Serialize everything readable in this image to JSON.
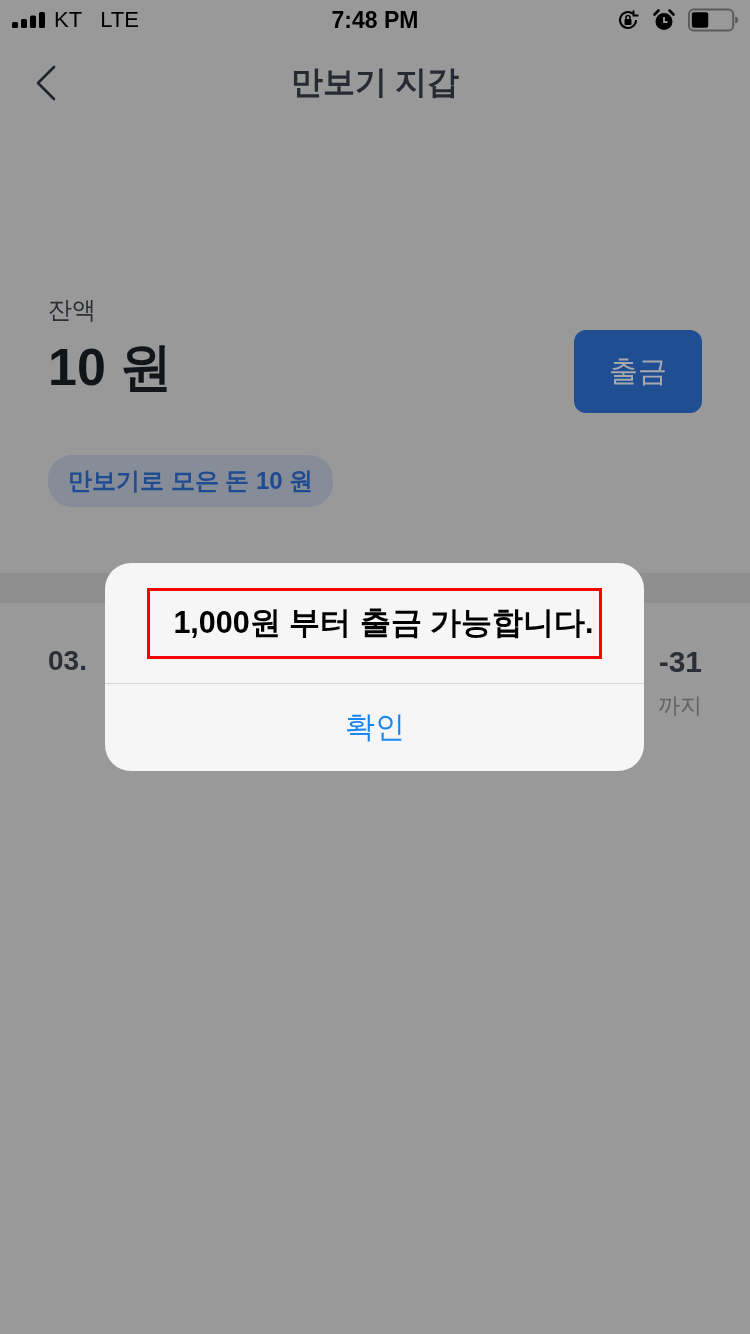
{
  "status_bar": {
    "carrier": "KT",
    "network": "LTE",
    "time": "7:48 PM"
  },
  "nav": {
    "title": "만보기 지갑"
  },
  "balance": {
    "label": "잔액",
    "amount": "10 원",
    "withdraw_button": "출금",
    "collected_chip": "만보기로 모은 돈 10 원"
  },
  "list_row": {
    "date_start": "03.",
    "date_end": "-31",
    "caption": "까지"
  },
  "alert": {
    "message": "1,000원 부터 출금 가능합니다.",
    "highlighted": true,
    "buttons": [
      "확인"
    ]
  }
}
